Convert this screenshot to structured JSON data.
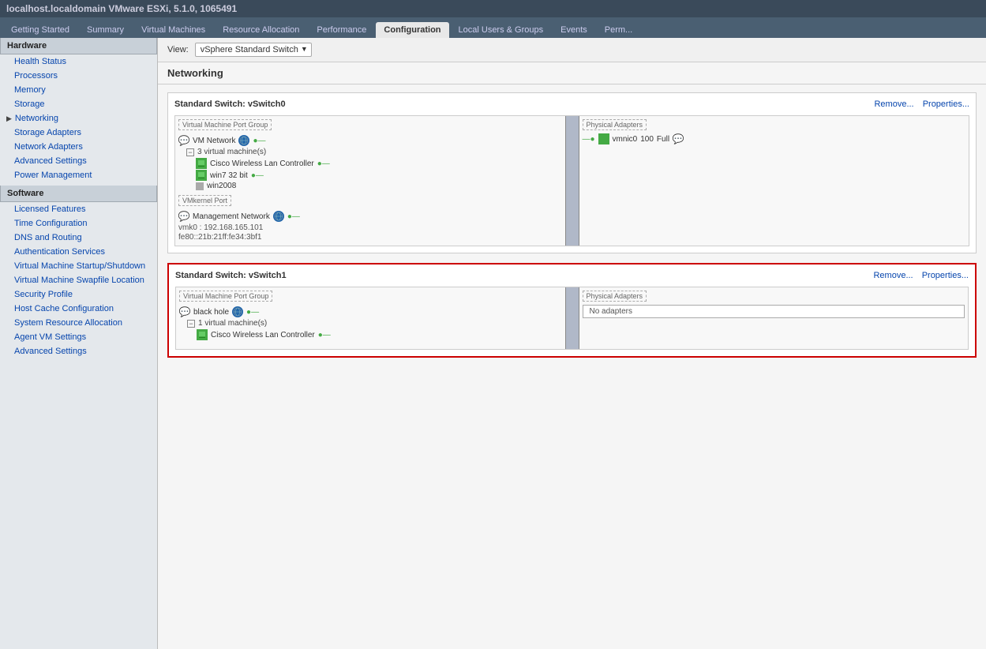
{
  "titleBar": {
    "text": "localhost.localdomain VMware ESXi, 5.1.0, 1065491"
  },
  "tabs": [
    {
      "label": "Getting Started",
      "active": false
    },
    {
      "label": "Summary",
      "active": false
    },
    {
      "label": "Virtual Machines",
      "active": false
    },
    {
      "label": "Resource Allocation",
      "active": false
    },
    {
      "label": "Performance",
      "active": false
    },
    {
      "label": "Configuration",
      "active": true
    },
    {
      "label": "Local Users & Groups",
      "active": false
    },
    {
      "label": "Events",
      "active": false
    },
    {
      "label": "Perm...",
      "active": false
    }
  ],
  "sidebar": {
    "hardware_header": "Hardware",
    "software_header": "Software",
    "hardware_items": [
      {
        "label": "Health Status",
        "indent": true,
        "arrow": false
      },
      {
        "label": "Processors",
        "indent": true,
        "arrow": false
      },
      {
        "label": "Memory",
        "indent": true,
        "arrow": false
      },
      {
        "label": "Storage",
        "indent": true,
        "arrow": false
      },
      {
        "label": "Networking",
        "indent": false,
        "arrow": true
      },
      {
        "label": "Storage Adapters",
        "indent": true,
        "arrow": false
      },
      {
        "label": "Network Adapters",
        "indent": true,
        "arrow": false
      },
      {
        "label": "Advanced Settings",
        "indent": true,
        "arrow": false
      },
      {
        "label": "Power Management",
        "indent": true,
        "arrow": false
      }
    ],
    "software_items": [
      {
        "label": "Licensed Features"
      },
      {
        "label": "Time Configuration"
      },
      {
        "label": "DNS and Routing"
      },
      {
        "label": "Authentication Services"
      },
      {
        "label": "Virtual Machine Startup/Shutdown"
      },
      {
        "label": "Virtual Machine Swapfile Location"
      },
      {
        "label": "Security Profile"
      },
      {
        "label": "Host Cache Configuration"
      },
      {
        "label": "System Resource Allocation"
      },
      {
        "label": "Agent VM Settings"
      },
      {
        "label": "Advanced Settings"
      }
    ]
  },
  "view": {
    "label": "View:",
    "dropdown": "vSphere Standard Switch"
  },
  "networking_heading": "Networking",
  "switches": [
    {
      "id": "vSwitch0",
      "title": "Standard Switch: vSwitch0",
      "remove_label": "Remove...",
      "properties_label": "Properties...",
      "highlighted": false,
      "port_group_label": "Virtual Machine Port Group",
      "physical_adapters_label": "Physical Adapters",
      "vm_network": {
        "name": "VM Network",
        "vm_count": "3 virtual machine(s)",
        "vms": [
          "Cisco Wireless Lan Controller",
          "win7 32 bit",
          "win2008"
        ]
      },
      "vmkernel": {
        "label": "VMkernel Port",
        "name": "Management Network",
        "vmk": "vmk0 : 192.168.165.101",
        "ipv6": "fe80::21b:21ff:fe34:3bf1"
      },
      "adapters": [
        {
          "name": "vmnic0",
          "speed": "100",
          "duplex": "Full"
        }
      ]
    },
    {
      "id": "vSwitch1",
      "title": "Standard Switch: vSwitch1",
      "remove_label": "Remove...",
      "properties_label": "Properties...",
      "highlighted": true,
      "port_group_label": "Virtual Machine Port Group",
      "physical_adapters_label": "Physical Adapters",
      "vm_network": {
        "name": "black hole",
        "vm_count": "1 virtual machine(s)",
        "vms": [
          "Cisco Wireless Lan Controller"
        ]
      },
      "adapters": [],
      "no_adapters_text": "No adapters"
    }
  ]
}
